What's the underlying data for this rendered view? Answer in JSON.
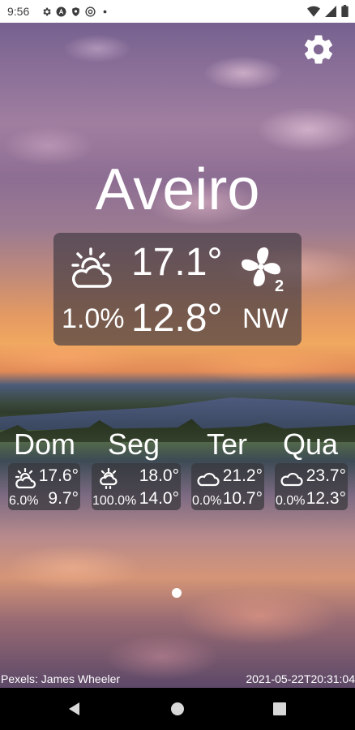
{
  "status_bar": {
    "time": "9:56",
    "left_icons": [
      "gear-icon",
      "a-circle-icon",
      "shield-icon",
      "at-circle-icon",
      "dot-icon"
    ],
    "right_icons": [
      "wifi-icon",
      "signal-icon",
      "battery-icon"
    ]
  },
  "settings": {
    "icon": "gear-icon"
  },
  "city": "Aveiro",
  "current": {
    "icon": "sun-cloud-icon",
    "temperature": "17.1°",
    "precipitation": "1.0%",
    "min_temperature": "12.8°",
    "wind_icon": "fan-icon",
    "wind_speed_class": "2",
    "wind_direction": "NW"
  },
  "forecast": [
    {
      "day": "Dom",
      "icon": "sun-cloud-icon",
      "max": "17.6°",
      "precip": "6.0%",
      "min": "9.7°"
    },
    {
      "day": "Seg",
      "icon": "sun-rain-icon",
      "max": "18.0°",
      "precip": "100.0%",
      "min": "14.0°"
    },
    {
      "day": "Ter",
      "icon": "cloud-icon",
      "max": "21.2°",
      "precip": "0.0%",
      "min": "10.7°"
    },
    {
      "day": "Qua",
      "icon": "cloud-icon",
      "max": "23.7°",
      "precip": "0.0%",
      "min": "12.3°"
    }
  ],
  "footer": {
    "credit": "Pexels: James Wheeler",
    "timestamp": "2021-05-22T20:31:04"
  },
  "nav": {
    "back_icon": "back-triangle-icon",
    "home_icon": "home-circle-icon",
    "recents_icon": "recents-square-icon"
  }
}
